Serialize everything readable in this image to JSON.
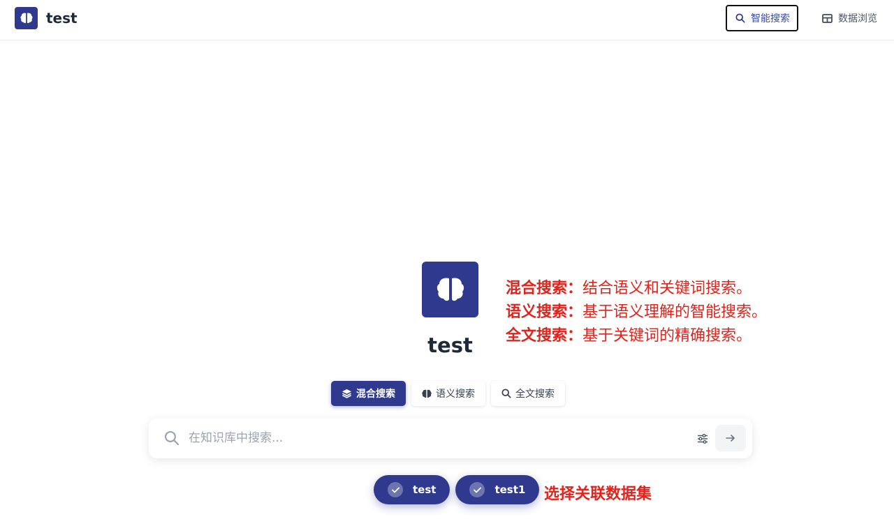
{
  "header": {
    "brand_name": "test",
    "nav": {
      "smart_search": "智能搜索",
      "data_browse": "数据浏览"
    }
  },
  "hero": {
    "title": "test"
  },
  "annotations": [
    {
      "key": "混合搜索：",
      "text": "结合语义和关键词搜索。"
    },
    {
      "key": "语义搜索：",
      "text": "基于语义理解的智能搜索。"
    },
    {
      "key": "全文搜索：",
      "text": "基于关键词的精确搜索。"
    }
  ],
  "search_modes": [
    {
      "label": "混合搜索",
      "active": true,
      "icon": "layers-icon"
    },
    {
      "label": "语义搜索",
      "active": false,
      "icon": "brain-icon"
    },
    {
      "label": "全文搜索",
      "active": false,
      "icon": "search-icon"
    }
  ],
  "search": {
    "placeholder": "在知识库中搜索...",
    "value": ""
  },
  "datasets": [
    {
      "label": "test",
      "selected": true
    },
    {
      "label": "test1",
      "selected": true
    }
  ],
  "dataset_hint": "选择关联数据集",
  "colors": {
    "brand": "#2f3a8f",
    "annotation": "#e0231c"
  }
}
